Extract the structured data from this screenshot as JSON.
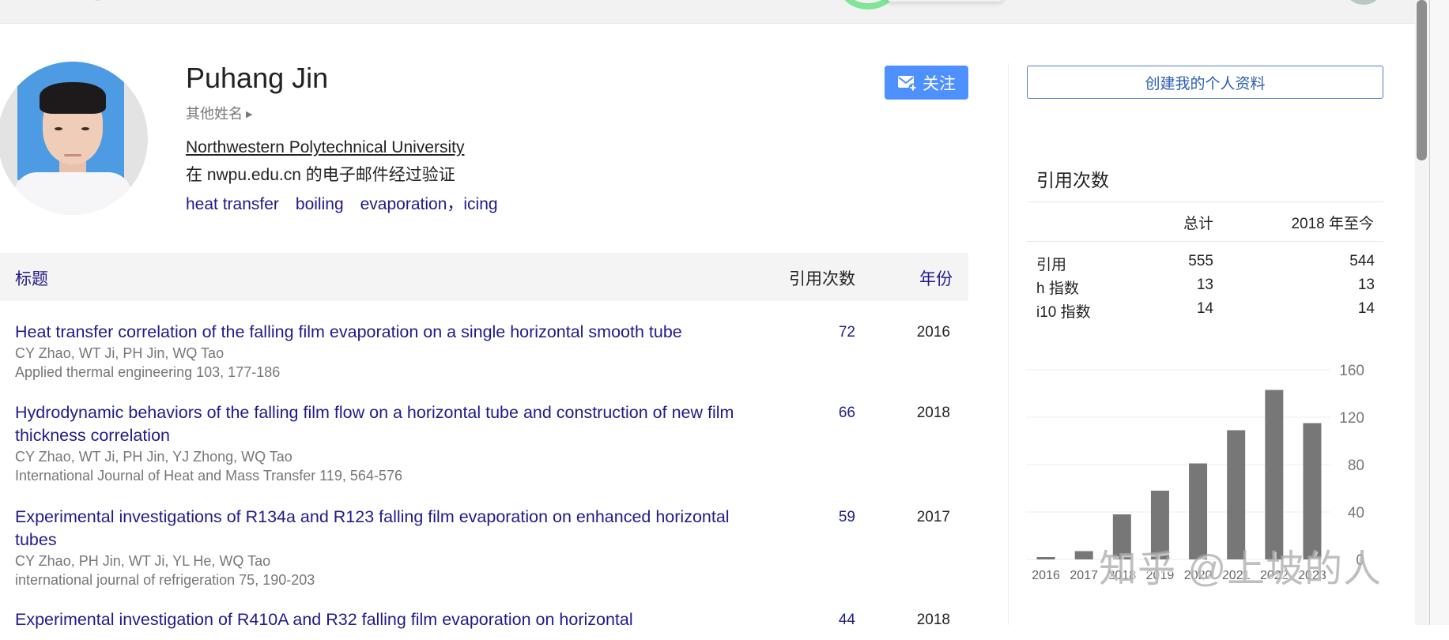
{
  "profile": {
    "name": "Puhang Jin",
    "other_names_label": "其他姓名",
    "affiliation": "Northwestern Polytechnical University",
    "verified_email": "在 nwpu.edu.cn 的电子邮件经过验证",
    "interests": [
      "heat transfer",
      "boiling",
      "evaporation，icing"
    ],
    "follow_label": "关注"
  },
  "table": {
    "headers": {
      "title": "标题",
      "cited_by": "引用次数",
      "year": "年份"
    },
    "rows": [
      {
        "title": "Heat transfer correlation of the falling film evaporation on a single horizontal smooth tube",
        "authors": "CY Zhao, WT Ji, PH Jin, WQ Tao",
        "venue": "Applied thermal engineering 103, 177-186",
        "cited_by": "72",
        "year": "2016"
      },
      {
        "title": "Hydrodynamic behaviors of the falling film flow on a horizontal tube and construction of new film thickness correlation",
        "authors": "CY Zhao, WT Ji, PH Jin, YJ Zhong, WQ Tao",
        "venue": "International Journal of Heat and Mass Transfer 119, 564-576",
        "cited_by": "66",
        "year": "2018"
      },
      {
        "title": "Experimental investigations of R134a and R123 falling film evaporation on enhanced horizontal tubes",
        "authors": "CY Zhao, PH Jin, WT Ji, YL He, WQ Tao",
        "venue": "international journal of refrigeration 75, 190-203",
        "cited_by": "59",
        "year": "2017"
      },
      {
        "title": "Experimental investigation of R410A and R32 falling film evaporation on horizontal",
        "authors": "",
        "venue": "",
        "cited_by": "44",
        "year": "2018"
      }
    ]
  },
  "sidebar": {
    "create_profile_label": "创建我的个人资料",
    "cited_by_heading": "引用次数",
    "stats_headers": {
      "total": "总计",
      "since": "2018 年至今"
    },
    "stats": [
      {
        "label": "引用",
        "total": "555",
        "since": "544"
      },
      {
        "label": "h 指数",
        "total": "13",
        "since": "13"
      },
      {
        "label": "i10 指数",
        "total": "14",
        "since": "14"
      }
    ]
  },
  "watermark": "知乎 @上坡的人",
  "colors": {
    "link": "#201a8a",
    "follow_button": "#4d90fe",
    "bar": "#777777"
  },
  "chart_data": {
    "type": "bar",
    "title": "",
    "xlabel": "",
    "ylabel": "",
    "categories": [
      "2016",
      "2017",
      "2018",
      "2019",
      "2020",
      "2021",
      "2022",
      "2023"
    ],
    "values": [
      2,
      7,
      38,
      58,
      81,
      109,
      143,
      115
    ],
    "ylim": [
      0,
      160
    ],
    "yticks": [
      "0",
      "40",
      "80",
      "120",
      "160"
    ],
    "ytick_values": [
      0,
      40,
      80,
      120,
      160
    ],
    "y_axis_side": "right",
    "grid": true,
    "legend": "none"
  }
}
